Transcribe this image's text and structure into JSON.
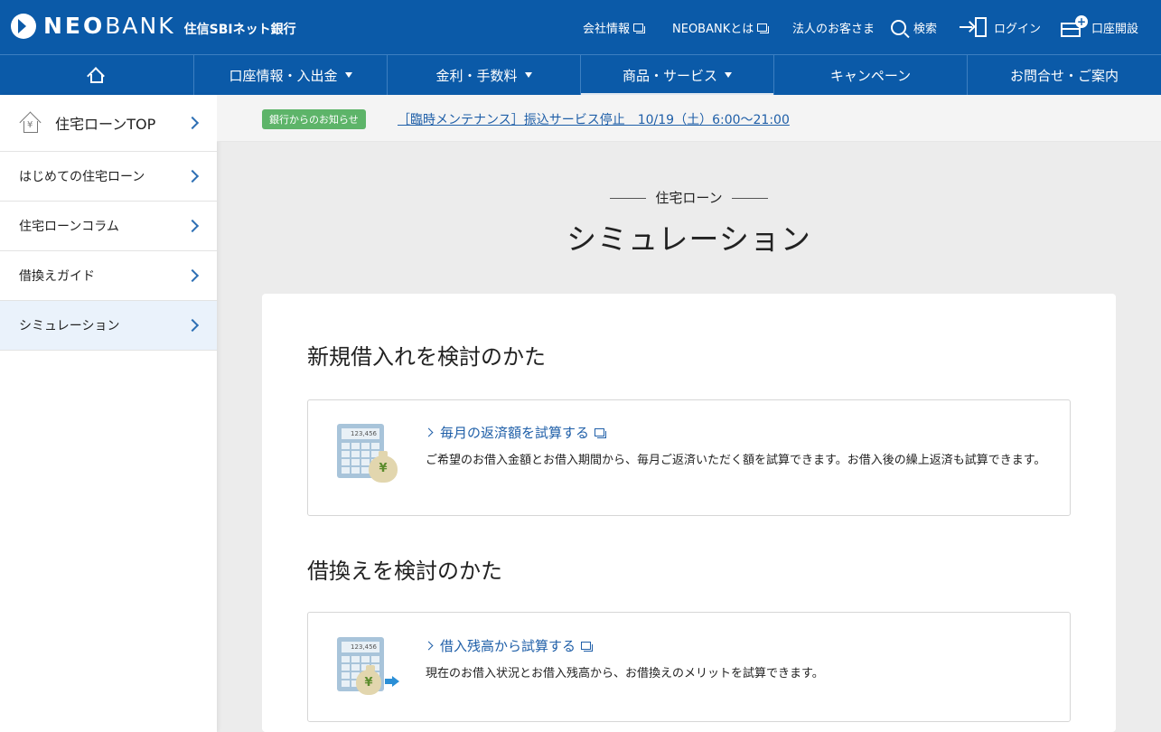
{
  "header": {
    "logo_neo": "NEO",
    "logo_bank": "BANK",
    "logo_sub": "住信SBIネット銀行",
    "links": {
      "company": "会社情報",
      "about": "NEOBANKとは",
      "corporate": "法人のお客さま",
      "search": "検索",
      "login": "ログイン",
      "open_account": "口座開設"
    }
  },
  "nav": {
    "account": "口座情報・入出金",
    "rates": "金利・手数料",
    "products": "商品・サービス",
    "campaign": "キャンペーン",
    "contact": "お問合せ・ご案内"
  },
  "sidebar": {
    "items": [
      {
        "label": "住宅ローンTOP"
      },
      {
        "label": "はじめての住宅ローン"
      },
      {
        "label": "住宅ローンコラム"
      },
      {
        "label": "借換えガイド"
      },
      {
        "label": "シミュレーション"
      }
    ]
  },
  "notice": {
    "badge": "銀行からのお知らせ",
    "text": "［臨時メンテナンス］振込サービス停止　10/19（土）6:00～21:00"
  },
  "page": {
    "subtitle": "住宅ローン",
    "title": "シミュレーション"
  },
  "sections": [
    {
      "title": "新規借入れを検討のかた",
      "card": {
        "link": "毎月の返済額を試算する",
        "desc": "ご希望のお借入金額とお借入期間から、毎月ご返済いただく額を試算できます。お借入後の繰上返済も試算できます。",
        "calc_display": "123,456",
        "yen": "¥"
      }
    },
    {
      "title": "借換えを検討のかた",
      "card": {
        "link": "借入残高から試算する",
        "desc": "現在のお借入状況とお借入残高から、お借換えのメリットを試算できます。",
        "calc_display": "123,456",
        "yen": "¥"
      }
    }
  ]
}
